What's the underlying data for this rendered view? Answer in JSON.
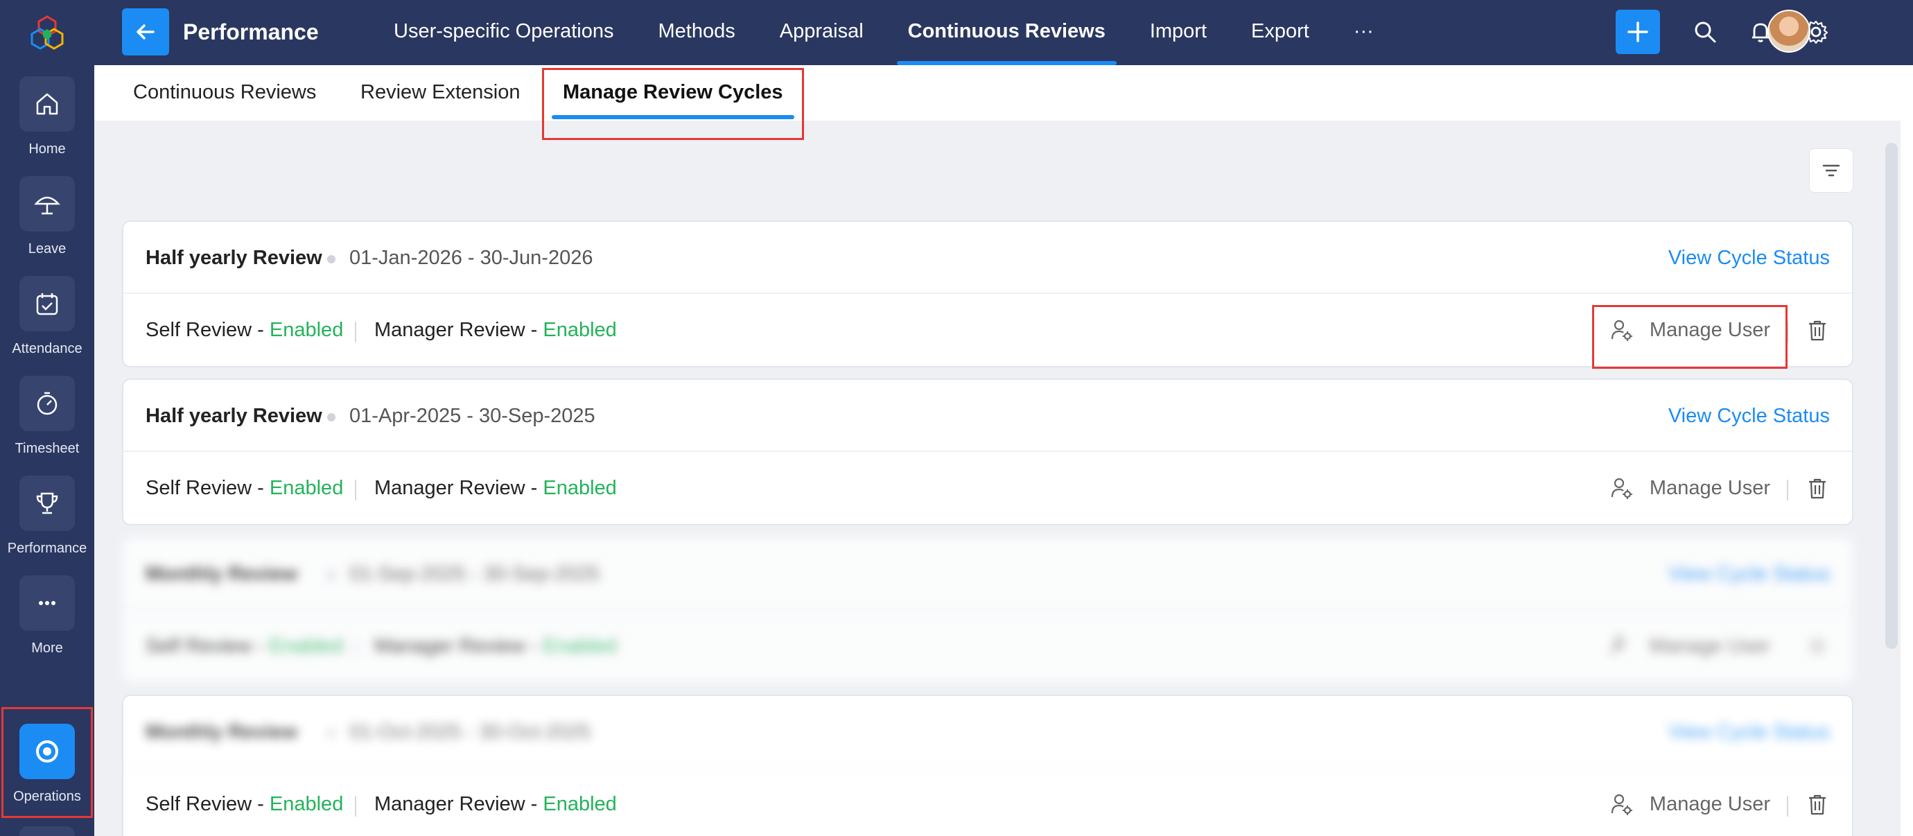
{
  "rail": {
    "items": [
      {
        "label": "Home",
        "icon": "home-icon"
      },
      {
        "label": "Leave",
        "icon": "umbrella-icon"
      },
      {
        "label": "Attendance",
        "icon": "calendar-check-icon"
      },
      {
        "label": "Timesheet",
        "icon": "stopwatch-icon"
      },
      {
        "label": "Performance",
        "icon": "trophy-icon"
      },
      {
        "label": "More",
        "icon": "more-dots-icon"
      },
      {
        "label": "Operations",
        "icon": "operations-icon"
      }
    ]
  },
  "header": {
    "title": "Performance",
    "nav": [
      {
        "label": "User-specific Operations"
      },
      {
        "label": "Methods"
      },
      {
        "label": "Appraisal"
      },
      {
        "label": "Continuous Reviews"
      },
      {
        "label": "Import"
      },
      {
        "label": "Export"
      },
      {
        "label": "···"
      }
    ],
    "active_nav": "Continuous Reviews"
  },
  "subtabs": {
    "items": [
      {
        "label": "Continuous Reviews"
      },
      {
        "label": "Review Extension"
      },
      {
        "label": "Manage Review Cycles"
      }
    ],
    "active": "Manage Review Cycles"
  },
  "cycles": [
    {
      "name": "Half yearly Review",
      "dates": "01-Jan-2026 - 30-Jun-2026",
      "view_label": "View Cycle Status",
      "self_label": "Self Review - ",
      "self_status": "Enabled",
      "manager_label": "Manager Review - ",
      "manager_status": "Enabled",
      "manage_label": "Manage User"
    },
    {
      "name": "Half yearly Review",
      "dates": "01-Apr-2025 - 30-Sep-2025",
      "view_label": "View Cycle Status",
      "self_label": "Self Review - ",
      "self_status": "Enabled",
      "manager_label": "Manager Review - ",
      "manager_status": "Enabled",
      "manage_label": "Manage User"
    },
    {
      "name": "Monthly Review",
      "dates": "01-Sep-2025 - 30-Sep-2025",
      "view_label": "View Cycle Status",
      "self_label": "Self Review - ",
      "self_status": "Enabled",
      "manager_label": "Manager Review - ",
      "manager_status": "Enabled",
      "manage_label": "Manage User"
    },
    {
      "name": "Monthly Review",
      "dates": "01-Oct-2025 - 30-Oct-2025",
      "view_label": "View Cycle Status",
      "self_label": "Self Review - ",
      "self_status": "Enabled",
      "manager_label": "Manager Review - ",
      "manager_status": "Enabled",
      "manage_label": "Manage User"
    }
  ],
  "colors": {
    "accent": "#1b8cf4",
    "rail": "#2a3760",
    "enabled": "#22b35a",
    "highlight": "#e53935"
  }
}
